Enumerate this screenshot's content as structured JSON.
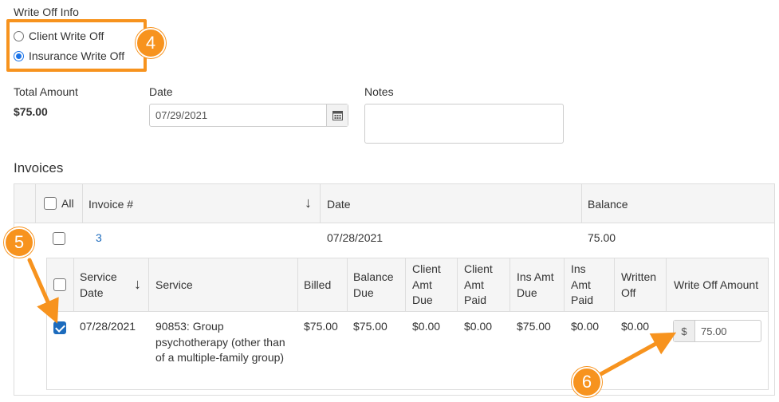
{
  "writeoff": {
    "section_title": "Write Off Info",
    "options": [
      {
        "label": "Client Write Off",
        "selected": false
      },
      {
        "label": "Insurance Write Off",
        "selected": true
      }
    ]
  },
  "callouts": {
    "step4": "4",
    "step5": "5",
    "step6": "6"
  },
  "total": {
    "label": "Total Amount",
    "value": "$75.00"
  },
  "date_field": {
    "label": "Date",
    "value": "07/29/2021",
    "icon": "calendar-icon"
  },
  "notes_field": {
    "label": "Notes",
    "value": ""
  },
  "invoices": {
    "title": "Invoices",
    "header": {
      "all_label": "All",
      "invoice_col": "Invoice #",
      "date_col": "Date",
      "balance_col": "Balance",
      "sort_icon": "sort-down-arrow-icon"
    },
    "row": {
      "invoice_number": "3",
      "date": "07/28/2021",
      "balance": "75.00",
      "checked": false
    },
    "detail": {
      "headers": {
        "service_date": "Service Date",
        "service": "Service",
        "billed": "Billed",
        "balance_due": "Balance Due",
        "client_amt_due": "Client Amt Due",
        "client_amt_paid": "Client Amt Paid",
        "ins_amt_due": "Ins Amt Due",
        "ins_amt_paid": "Ins Amt Paid",
        "written_off": "Written Off",
        "write_off_amount": "Write Off Amount"
      },
      "row": {
        "checked": true,
        "service_date": "07/28/2021",
        "service": "90853: Group psychotherapy (other than of a multiple-family group)",
        "billed": "$75.00",
        "balance_due": "$75.00",
        "client_amt_due": "$0.00",
        "client_amt_paid": "$0.00",
        "ins_amt_due": "$75.00",
        "ins_amt_paid": "$0.00",
        "written_off": "$0.00",
        "currency_symbol": "$",
        "write_off_amount": "75.00"
      }
    }
  },
  "colors": {
    "accent": "#f7931e",
    "link": "#1c6bbd",
    "checkbox_checked": "#1c6bbd"
  }
}
